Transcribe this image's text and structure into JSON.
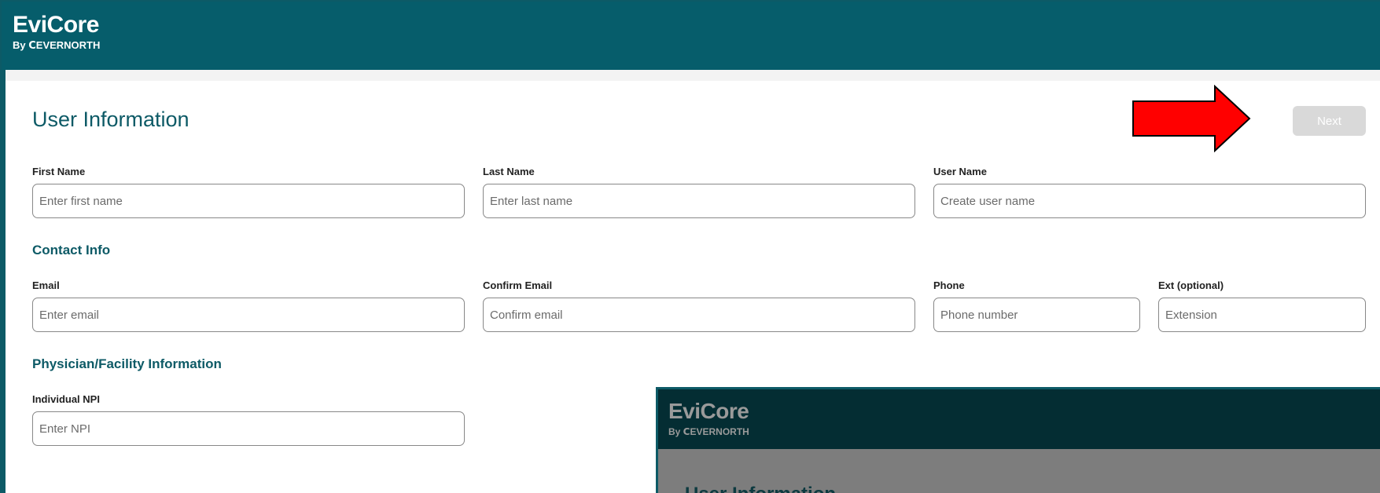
{
  "header": {
    "logo_main": "EviCore",
    "logo_sub": "By ⅭEVERNORTH"
  },
  "page": {
    "title": "User Information",
    "next_label": "Next"
  },
  "user_fields": {
    "first_name": {
      "label": "First Name",
      "placeholder": "Enter first name"
    },
    "last_name": {
      "label": "Last Name",
      "placeholder": "Enter last name"
    },
    "user_name": {
      "label": "User Name",
      "placeholder": "Create user name"
    }
  },
  "contact": {
    "section_title": "Contact Info",
    "email": {
      "label": "Email",
      "placeholder": "Enter email"
    },
    "confirm_email": {
      "label": "Confirm Email",
      "placeholder": "Confirm email"
    },
    "phone": {
      "label": "Phone",
      "placeholder": "Phone number"
    },
    "ext": {
      "label": "Ext (optional)",
      "placeholder": "Extension"
    }
  },
  "physician": {
    "section_title": "Physician/Facility Information",
    "npi": {
      "label": "Individual NPI",
      "placeholder": "Enter NPI"
    }
  },
  "overlay": {
    "logo_main": "EviCore",
    "logo_sub": "By ⅭEVERNORTH",
    "title": "User Information"
  },
  "colors": {
    "header_bg": "#065d6b",
    "accent_text": "#0d5a66",
    "annotation_arrow": "#ff0000",
    "next_disabled": "#d9d9d9"
  }
}
